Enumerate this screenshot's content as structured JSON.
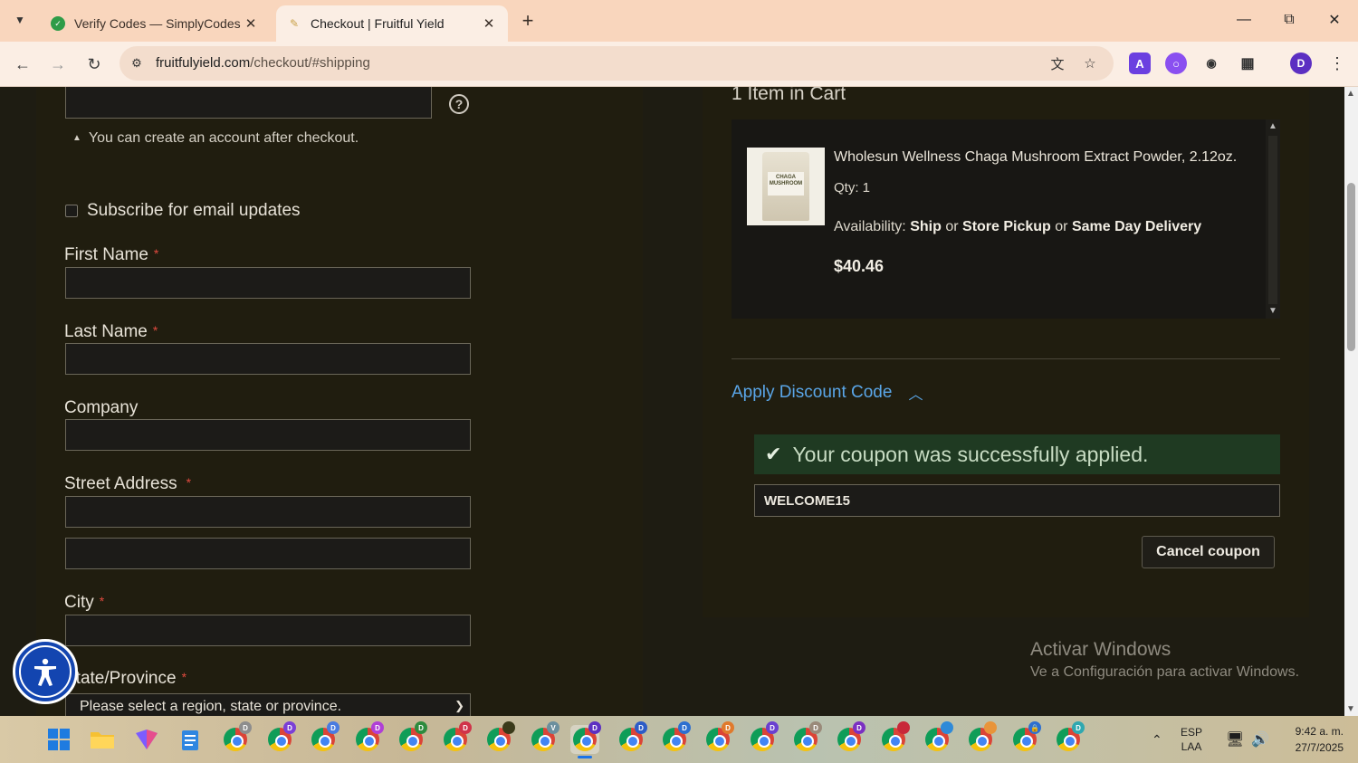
{
  "browser": {
    "tabs": [
      {
        "title": "Verify Codes — SimplyCodes",
        "active": false
      },
      {
        "title": "Checkout | Fruitful Yield",
        "active": true
      }
    ],
    "url_domain": "fruitfulyield.com",
    "url_path": "/checkout/#shipping",
    "profile_initial": "D"
  },
  "form": {
    "account_note": "You can create an account after checkout.",
    "subscribe_label": "Subscribe for email updates",
    "first_name_label": "First Name",
    "last_name_label": "Last Name",
    "company_label": "Company",
    "street_label": "Street Address",
    "city_label": "City",
    "state_label": "State/Province",
    "state_select_value": "Please select a region, state or province.",
    "required_mark": "*"
  },
  "cart": {
    "title": "1 Item in Cart",
    "product": {
      "name": "Wholesun Wellness Chaga Mushroom Extract Powder, 2.12oz.",
      "qty": "Qty: 1",
      "availability_prefix": "Availability:",
      "ship": "Ship",
      "or1": "or",
      "pickup": "Store Pickup",
      "or2": "or",
      "same_day": "Same Day Delivery",
      "price": "$40.46",
      "image_label": "CHAGA MUSHROOM"
    }
  },
  "discount": {
    "link_label": "Apply Discount Code",
    "success_message": "Your coupon was successfully applied.",
    "code": "WELCOME15",
    "cancel_label": "Cancel coupon"
  },
  "watermark": {
    "line1": "Activar Windows",
    "line2": "Ve a Configuración para activar Windows."
  },
  "taskbar": {
    "lang_line1": "ESP",
    "lang_line2": "LAA",
    "time": "9:42 a. m.",
    "date": "27/7/2025",
    "chrome_badges": [
      "D",
      "D",
      "D",
      "D",
      "D",
      "D",
      "",
      "V",
      "D",
      "D",
      "D",
      "D",
      "D",
      "D",
      "D",
      "",
      "",
      "",
      "D"
    ]
  },
  "colors": {
    "accent_link": "#5aa6e8",
    "success_bg": "#1f3a22",
    "required": "#e04a3f",
    "page_bg": "#1e1c12"
  }
}
